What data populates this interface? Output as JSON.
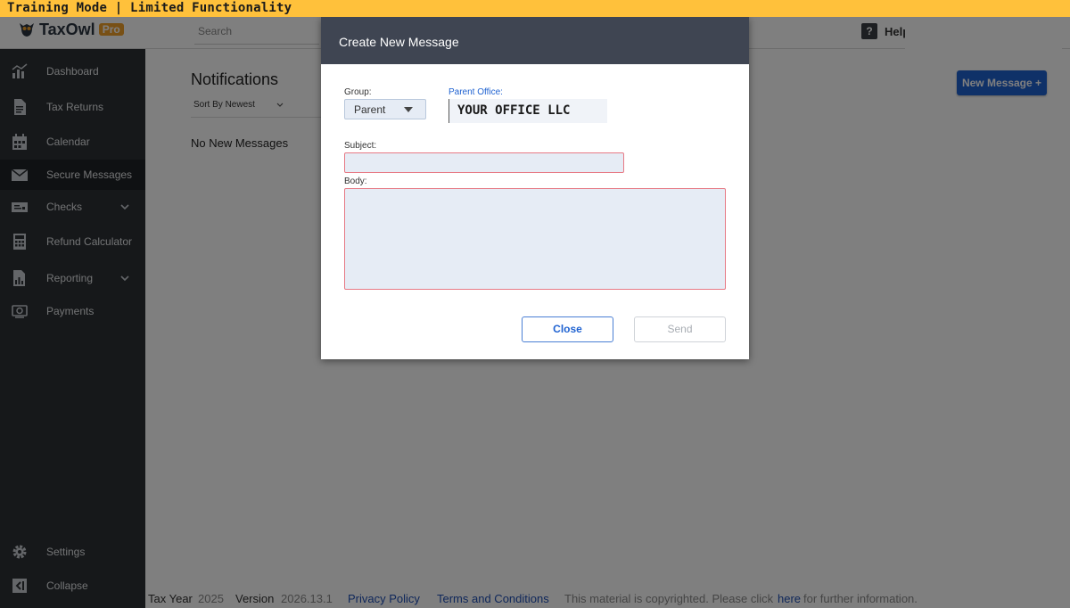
{
  "banner": {
    "text": "Training Mode | Limited Functionality"
  },
  "header": {
    "logo_name": "TaxOwl",
    "logo_badge": "Pro",
    "search_placeholder": "Search",
    "help_label": "Help"
  },
  "sidebar": {
    "items": [
      {
        "label": "Dashboard",
        "icon": "dashboard-icon"
      },
      {
        "label": "Tax Returns",
        "icon": "document-icon"
      },
      {
        "label": "Calendar",
        "icon": "calendar-icon"
      },
      {
        "label": "Secure Messages",
        "icon": "envelope-icon",
        "active": true
      },
      {
        "label": "Checks",
        "icon": "check-icon",
        "expandable": true
      },
      {
        "label": "Refund Calculator",
        "icon": "calculator-icon"
      },
      {
        "label": "Reporting",
        "icon": "report-icon",
        "expandable": true
      },
      {
        "label": "Payments",
        "icon": "payment-icon"
      }
    ],
    "settings_label": "Settings",
    "collapse_label": "Collapse"
  },
  "main": {
    "title": "Notifications",
    "sort_label": "Sort By Newest",
    "empty_text": "No New Messages",
    "new_message_button": "New Message +"
  },
  "footer": {
    "tax_year_label": "Tax Year",
    "tax_year_value": "2025",
    "version_label": "Version",
    "version_value": "2026.13.1",
    "privacy_link": "Privacy Policy",
    "terms_link": "Terms and Conditions",
    "copyright_text": "This material is copyrighted. Please click",
    "here_link": "here",
    "copyright_tail": "for further information."
  },
  "modal": {
    "title": "Create New Message",
    "group_label": "Group:",
    "group_value": "Parent",
    "parent_office_label": "Parent Office:",
    "parent_office_value": "YOUR OFFICE LLC",
    "subject_label": "Subject:",
    "subject_value": "",
    "body_label": "Body:",
    "body_value": "",
    "close_button": "Close",
    "send_button": "Send"
  },
  "colors": {
    "banner": "#ffc13b",
    "sidebar": "#2c3035",
    "accent": "#1f62d1",
    "invalid_border": "#e77a85"
  }
}
